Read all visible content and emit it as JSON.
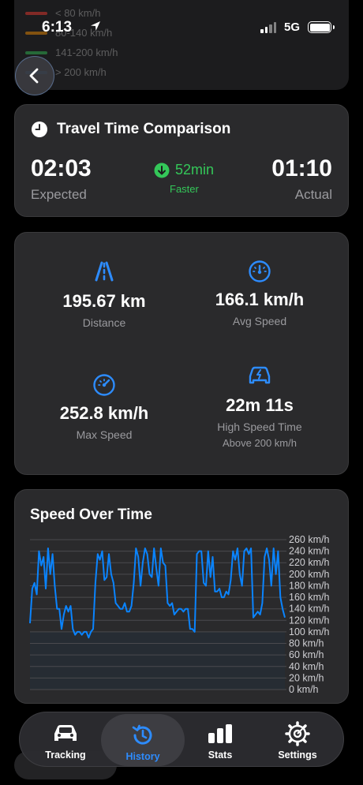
{
  "status_bar": {
    "time": "6:13",
    "network": "5G"
  },
  "legend": {
    "items": [
      {
        "label": "< 80 km/h",
        "color": "#ff3b30"
      },
      {
        "label": "80-140 km/h",
        "color": "#ff9500"
      },
      {
        "label": "141-200 km/h",
        "color": "#34c759"
      },
      {
        "label": "> 200 km/h",
        "color": "#0a84ff"
      }
    ]
  },
  "travel_time": {
    "title": "Travel Time Comparison",
    "expected_value": "02:03",
    "expected_label": "Expected",
    "actual_value": "01:10",
    "actual_label": "Actual",
    "difference": "52min",
    "difference_label": "Faster"
  },
  "stats": {
    "distance": {
      "value": "195.67 km",
      "label": "Distance"
    },
    "avg_speed": {
      "value": "166.1 km/h",
      "label": "Avg Speed"
    },
    "max_speed": {
      "value": "252.8 km/h",
      "label": "Max Speed"
    },
    "high_speed": {
      "value": "22m 11s",
      "label": "High Speed Time",
      "sublabel": "Above 200 km/h"
    }
  },
  "chart_title": "Speed Over Time",
  "chart_data": {
    "type": "line",
    "title": "Speed Over Time",
    "yunit": "km/h",
    "ylim": [
      0,
      260
    ],
    "y_ticks": [
      "260 km/h",
      "240 km/h",
      "220 km/h",
      "200 km/h",
      "180 km/h",
      "160 km/h",
      "140 km/h",
      "120 km/h",
      "100 km/h",
      "80 km/h",
      "60 km/h",
      "40 km/h",
      "20 km/h",
      "0 km/h"
    ],
    "grid": true,
    "line_color": "#0a84ff",
    "series": [
      {
        "values": [
          115,
          175,
          185,
          165,
          240,
          215,
          230,
          175,
          245,
          200,
          235,
          180,
          140,
          140,
          105,
          130,
          145,
          135,
          145,
          105,
          95,
          100,
          100,
          95,
          100,
          100,
          90,
          100,
          105,
          185,
          235,
          225,
          240,
          190,
          195,
          235,
          200,
          185,
          150,
          145,
          140,
          140,
          150,
          135,
          135,
          145,
          185,
          245,
          230,
          180,
          220,
          245,
          235,
          200,
          195,
          245,
          210,
          180,
          245,
          220,
          215,
          150,
          145,
          150,
          130,
          135,
          140,
          140,
          135,
          140,
          140,
          105,
          105,
          100,
          235,
          240,
          240,
          185,
          180,
          240,
          195,
          230,
          170,
          170,
          175,
          160,
          160,
          170,
          165,
          190,
          240,
          225,
          245,
          200,
          180,
          240,
          245,
          235,
          245,
          125,
          130,
          135,
          130,
          150,
          230,
          245,
          225,
          180,
          245,
          200,
          240,
          160,
          140,
          125
        ]
      }
    ]
  },
  "tabs": [
    {
      "label": "Tracking"
    },
    {
      "label": "History"
    },
    {
      "label": "Stats"
    },
    {
      "label": "Settings"
    }
  ],
  "colors": {
    "accent": "#2d8cff",
    "positive": "#34c759",
    "card": "#2a2a2c"
  }
}
